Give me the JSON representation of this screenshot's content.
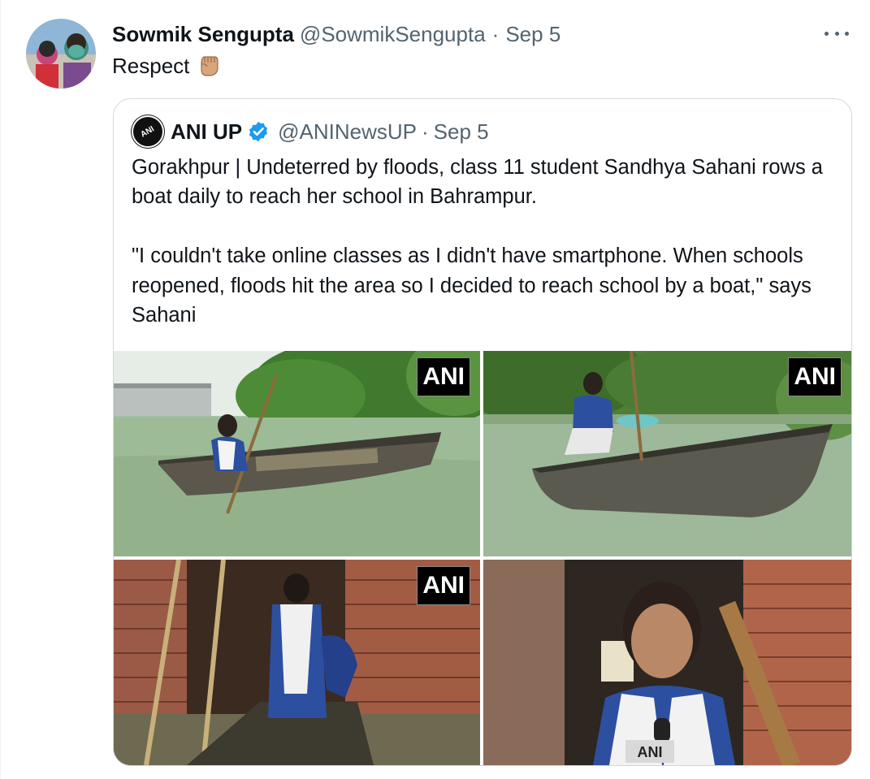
{
  "tweet": {
    "author_name": "Sowmik Sengupta",
    "author_handle": "@SowmikSengupta",
    "separator": "·",
    "date": "Sep 5",
    "text": "Respect",
    "emoji": "raised-fist-emoji"
  },
  "quoted_tweet": {
    "author_name": "ANI UP",
    "author_handle": "@ANINewsUP",
    "separator": "·",
    "date": "Sep 5",
    "avatar_text": "ANI",
    "paragraphs": [
      "Gorakhpur | Undeterred by floods, class 11 student Sandhya Sahani rows a boat daily to reach her school in Bahrampur.",
      "\"I couldn't take online classes as I didn't have smartphone. When schools reopened, floods hit the area so I decided to reach school by a boat,\" says Sahani"
    ],
    "media": [
      {
        "watermark": "ANI"
      },
      {
        "watermark": "ANI"
      },
      {
        "watermark": "ANI"
      },
      {
        "watermark": "ANI"
      }
    ]
  },
  "icons": {
    "more": "more-icon",
    "verified": "verified-badge-icon"
  },
  "colors": {
    "text": "#0f1419",
    "secondary": "#536471",
    "verified": "#1d9bf0",
    "border": "#cfd9de"
  }
}
